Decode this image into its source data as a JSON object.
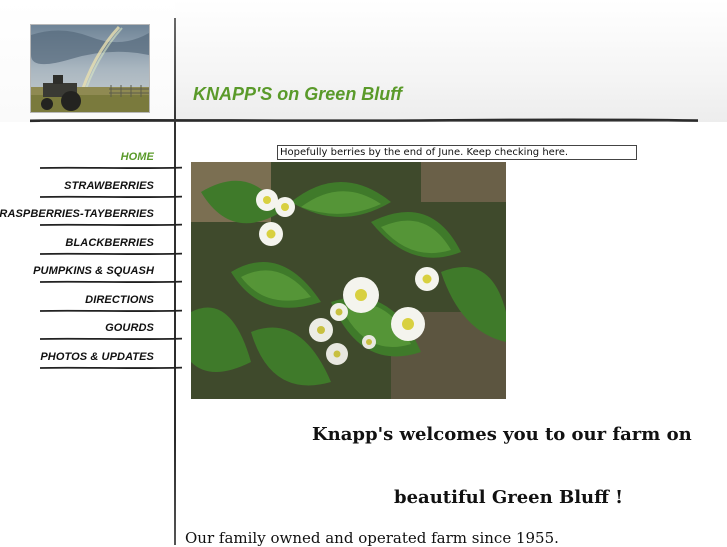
{
  "site": {
    "title": "KNAPP'S on Green Bluff"
  },
  "nav": {
    "items": [
      {
        "label": "HOME",
        "active": true
      },
      {
        "label": "STRAWBERRIES",
        "active": false
      },
      {
        "label": "RASPBERRIES-TAYBERRIES",
        "active": false
      },
      {
        "label": "BLACKBERRIES",
        "active": false
      },
      {
        "label": "PUMPKINS & SQUASH",
        "active": false
      },
      {
        "label": "DIRECTIONS",
        "active": false
      },
      {
        "label": "GOURDS",
        "active": false
      },
      {
        "label": "PHOTOS & UPDATES",
        "active": false
      }
    ]
  },
  "notice": {
    "text": "Hopefully berries by the end of June. Keep checking here."
  },
  "main": {
    "welcome_line1": "Knapp's welcomes you to our farm on",
    "welcome_line2": "beautiful Green Bluff !",
    "family_text": "Our family owned and operated farm since 1955."
  },
  "colors": {
    "accent": "#5a9a2a",
    "text": "#111111"
  }
}
